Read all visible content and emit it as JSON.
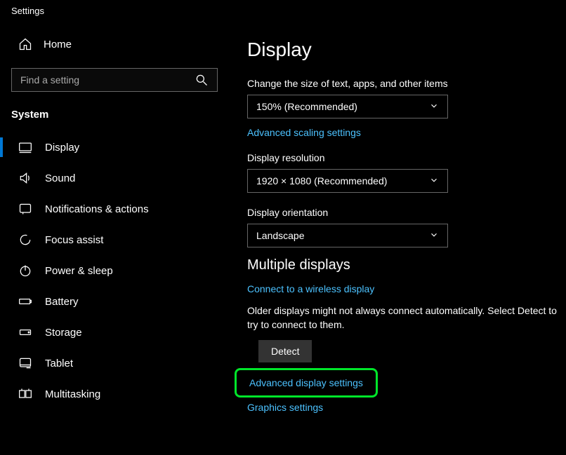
{
  "window": {
    "title": "Settings"
  },
  "sidebar": {
    "home_label": "Home",
    "search_placeholder": "Find a setting",
    "section": "System",
    "items": [
      {
        "label": "Display"
      },
      {
        "label": "Sound"
      },
      {
        "label": "Notifications & actions"
      },
      {
        "label": "Focus assist"
      },
      {
        "label": "Power & sleep"
      },
      {
        "label": "Battery"
      },
      {
        "label": "Storage"
      },
      {
        "label": "Tablet"
      },
      {
        "label": "Multitasking"
      }
    ]
  },
  "main": {
    "heading": "Display",
    "scale": {
      "label": "Change the size of text, apps, and other items",
      "value": "150% (Recommended)",
      "link": "Advanced scaling settings"
    },
    "resolution": {
      "label": "Display resolution",
      "value": "1920 × 1080 (Recommended)"
    },
    "orientation": {
      "label": "Display orientation",
      "value": "Landscape"
    },
    "multiple": {
      "heading": "Multiple displays",
      "wireless_link": "Connect to a wireless display",
      "detect_text": "Older displays might not always connect automatically. Select Detect to try to connect to them.",
      "detect_button": "Detect",
      "advanced_link": "Advanced display settings",
      "graphics_link": "Graphics settings"
    }
  }
}
